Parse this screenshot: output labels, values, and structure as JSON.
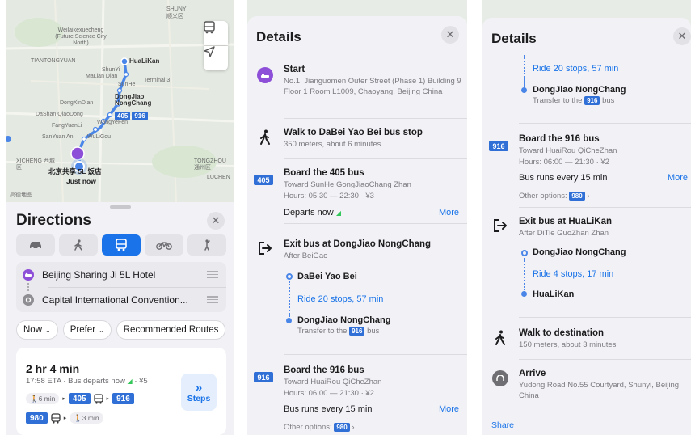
{
  "map": {
    "labels": {
      "shunyi_cn": "SHUNYI",
      "shunyi_district": "顺义区",
      "weilaikexuecheng": "Weilaikexuecheng (Future Science City North)",
      "tiantongyuan": "TIANTONGYUAN",
      "shunyi_station": "ShunYi",
      "malian_dian": "MaLian Dian",
      "terminal3": "Terminal 3",
      "sunhe": "SunHe",
      "huali_kan": "HuaLiKan",
      "dongxindian": "DongXinDian",
      "dongjiao": "DongJiao NongChang",
      "dashan_qiaodong": "DaShan QiaoDong",
      "wangyefen": "WangYeFen",
      "fangyuan": "FangYuanLi",
      "sanyuan_an": "SanYuan An",
      "wuliqou": "WuLiGou",
      "xicheng": "XICHENG 西城区",
      "tongzhou": "TONGZHOU 通州区",
      "luchen": "LUCHEN",
      "hotel_label": "北京共享 5L 饭店",
      "just_now": "Just now",
      "credit": "高德地图"
    },
    "badges": [
      "405",
      "916"
    ]
  },
  "directions": {
    "title": "Directions",
    "origin": "Beijing Sharing Ji 5L Hotel",
    "destination": "Capital International Convention...",
    "filters": [
      "Now",
      "Prefer",
      "Recommended Routes"
    ],
    "route": {
      "duration": "2 hr 4 min",
      "eta": "17:58 ETA · Bus departs now",
      "fare": "¥5",
      "walk1": "6 min",
      "line1": "405",
      "line2": "916",
      "line3": "980",
      "walk2": "3 min",
      "steps_label": "Steps"
    }
  },
  "details_a": {
    "title": "Details",
    "start": {
      "title": "Start",
      "address": "No.1, Jianguomen Outer Street (Phase 1) Building 9 Floor 1 Room L1009, Chaoyang, Beijing China"
    },
    "walk": {
      "title": "Walk to DaBei Yao Bei bus stop",
      "sub": "350 meters, about 6 minutes"
    },
    "board405": {
      "line": "405",
      "title": "Board the 405 bus",
      "toward": "Toward SunHe GongJiaoChang Zhan",
      "hours": "Hours: 05:30 — 22:30 · ¥3",
      "departs": "Departs now",
      "more": "More"
    },
    "exit": {
      "title": "Exit bus at DongJiao NongChang",
      "after": "After BeiGao",
      "from_stop": "DaBei Yao Bei",
      "ride": "Ride 20 stops, 57 min",
      "to_stop": "DongJiao NongChang",
      "transfer_pre": "Transfer to the",
      "transfer_line": "916",
      "transfer_post": "bus"
    },
    "board916": {
      "line": "916",
      "title": "Board the 916 bus",
      "toward": "Toward HuaiRou QiCheZhan",
      "hours": "Hours: 06:00 — 21:30 · ¥2",
      "frequency": "Bus runs every 15 min",
      "more": "More",
      "other_pre": "Other options:",
      "other_line": "980"
    }
  },
  "details_b": {
    "title": "Details",
    "ride": "Ride 20 stops, 57 min",
    "to_stop": "DongJiao NongChang",
    "transfer_pre": "Transfer to the",
    "transfer_line": "916",
    "transfer_post": "bus",
    "board916": {
      "line": "916",
      "title": "Board the 916 bus",
      "toward": "Toward HuaiRou QiCheZhan",
      "hours": "Hours: 06:00 — 21:30 · ¥2",
      "frequency": "Bus runs every 15 min",
      "more": "More",
      "other_pre": "Other options:",
      "other_line": "980"
    },
    "exit": {
      "title": "Exit bus at HuaLiKan",
      "after": "After DiTie GuoZhan Zhan",
      "from_stop": "DongJiao NongChang",
      "ride": "Ride 4 stops, 17 min",
      "to_stop": "HuaLiKan"
    },
    "walk": {
      "title": "Walk to destination",
      "sub": "150 meters, about 3 minutes"
    },
    "arrive": {
      "title": "Arrive",
      "address": "Yudong Road No.55 Courtyard, Shunyi, Beijing China"
    },
    "share": "Share"
  },
  "colors": {
    "accent": "#1a73e8",
    "bus_badge": "#2f6fd6",
    "start_pin": "#8e4fd8",
    "route_line": "#4a86e8"
  }
}
